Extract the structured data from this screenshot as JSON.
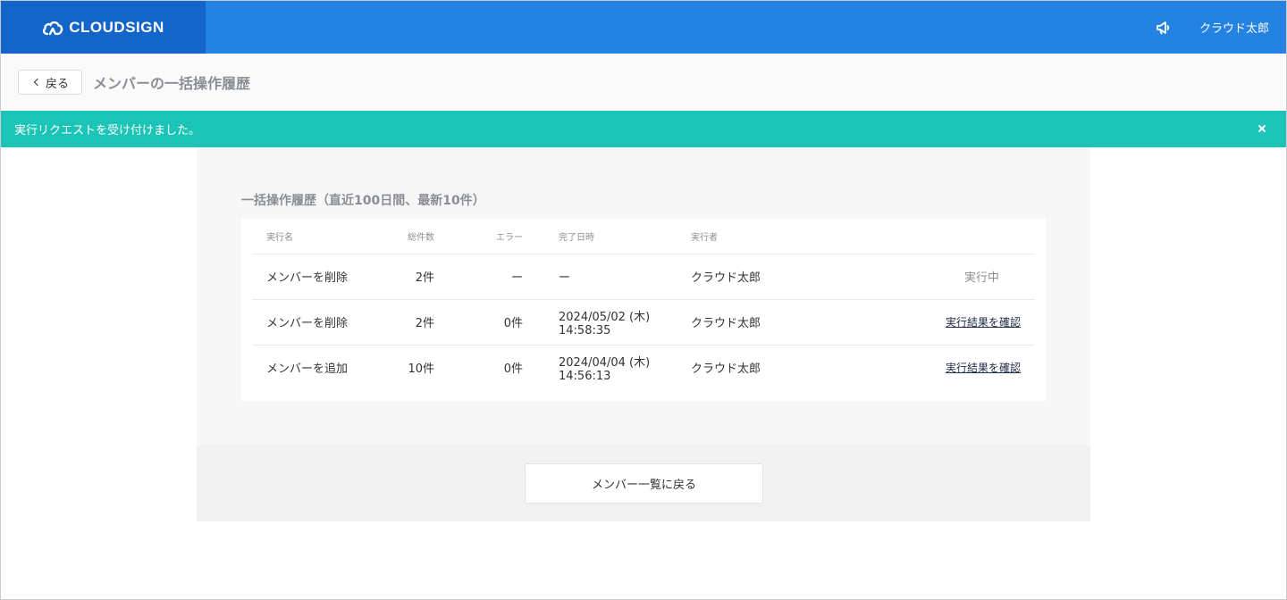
{
  "header": {
    "brand": "CLOUDSIGN",
    "brand_icon": "cloud-sign-logo-icon",
    "announce_icon": "megaphone-icon",
    "user_name": "クラウド太郎",
    "colors": {
      "bar": "#2482e2",
      "brand_block": "#1465c9"
    }
  },
  "subheader": {
    "back_label": "戻る",
    "back_icon": "chevron-left-icon",
    "title": "メンバーの一括操作履歴"
  },
  "notice": {
    "message": "実行リクエストを受け付けました。",
    "close_icon": "close-icon",
    "color": "#1bc4b6"
  },
  "history": {
    "section_title": "一括操作履歴（直近100日間、最新10件）",
    "columns": {
      "name": "実行名",
      "total": "総件数",
      "errors": "エラー",
      "completed_at": "完了日時",
      "executor": "実行者"
    },
    "rows": [
      {
        "name": "メンバーを削除",
        "total": "2件",
        "errors": "ー",
        "completed_at": "ー",
        "executor": "クラウド太郎",
        "status": "実行中"
      },
      {
        "name": "メンバーを削除",
        "total": "2件",
        "errors": "0件",
        "completed_at": "2024/05/02 (木) 14:58:35",
        "executor": "クラウド太郎",
        "action": "実行結果を確認"
      },
      {
        "name": "メンバーを追加",
        "total": "10件",
        "errors": "0件",
        "completed_at": "2024/04/04 (木) 14:56:13",
        "executor": "クラウド太郎",
        "action": "実行結果を確認"
      }
    ]
  },
  "footer": {
    "return_label": "メンバー一覧に戻る"
  }
}
